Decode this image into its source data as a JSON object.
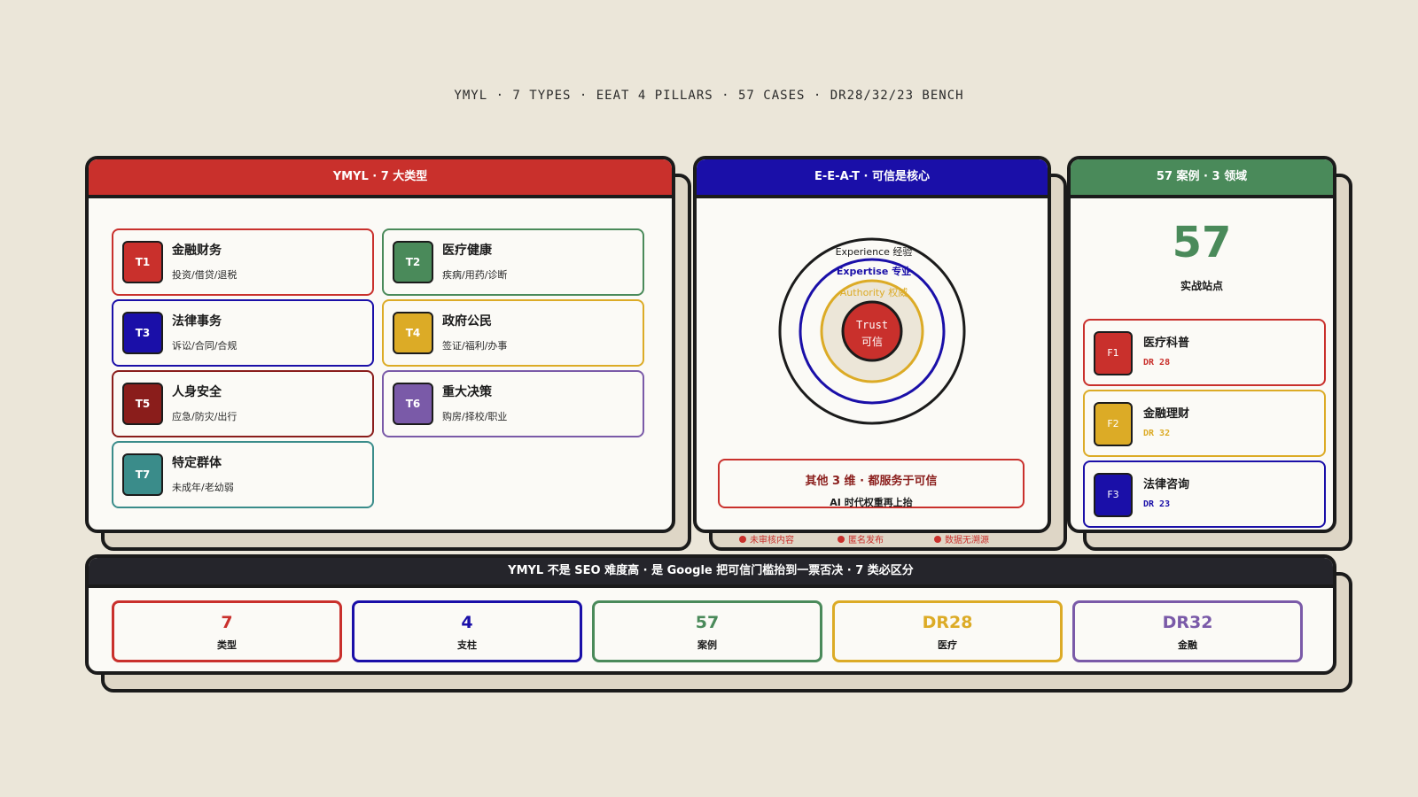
{
  "header_strip": "YMYL · 7 TYPES · EEAT 4 PILLARS · 57 CASES · DR28/32/23 BENCH",
  "colors": {
    "red": "#c9302c",
    "blue": "#1a0fa8",
    "green": "#4a8a5a",
    "yellow": "#dcab26",
    "darkred": "#8a1d1b",
    "purple": "#7a5aa8",
    "teal": "#3a8c8a",
    "dark": "#25252b"
  },
  "types_panel": {
    "title": "YMYL · 7 大类型",
    "items": [
      {
        "code": "T1",
        "title": "金融财务",
        "desc": "投资/借贷/退税",
        "color": "#c9302c"
      },
      {
        "code": "T2",
        "title": "医疗健康",
        "desc": "疾病/用药/诊断",
        "color": "#4a8a5a"
      },
      {
        "code": "T3",
        "title": "法律事务",
        "desc": "诉讼/合同/合规",
        "color": "#1a0fa8"
      },
      {
        "code": "T4",
        "title": "政府公民",
        "desc": "签证/福利/办事",
        "color": "#dcab26"
      },
      {
        "code": "T5",
        "title": "人身安全",
        "desc": "应急/防灾/出行",
        "color": "#8a1d1b"
      },
      {
        "code": "T6",
        "title": "重大决策",
        "desc": "购房/择校/职业",
        "color": "#7a5aa8"
      },
      {
        "code": "T7",
        "title": "特定群体",
        "desc": "未成年/老幼弱",
        "color": "#3a8c8a"
      }
    ]
  },
  "eeat_panel": {
    "title": "E-E-A-T · 可信是核心",
    "rings": {
      "experience": "Experience 经验",
      "expertise": "Expertise 专业",
      "authority": "Authority 权威",
      "trust_en": "Trust",
      "trust_cn": "可信"
    },
    "callout_title": "其他 3 维 · 都服务于可信",
    "callout_sub": "AI 时代权重再上抬",
    "notes": [
      "未审核内容",
      "匿名发布",
      "数据无溯源"
    ]
  },
  "cases_panel": {
    "title": "57 案例 · 3 领域",
    "big_number": "57",
    "big_label": "实战站点",
    "items": [
      {
        "code": "F1",
        "title": "医疗科普",
        "dr": "DR  28",
        "color": "#c9302c"
      },
      {
        "code": "F2",
        "title": "金融理财",
        "dr": "DR  32",
        "color": "#dcab26"
      },
      {
        "code": "F3",
        "title": "法律咨询",
        "dr": "DR  23",
        "color": "#1a0fa8"
      }
    ]
  },
  "bottom_panel": {
    "title": "YMYL 不是 SEO 难度高 · 是 Google 把可信门槛抬到一票否决 · 7 类必区分",
    "stats": [
      {
        "value": "7",
        "label": "类型",
        "color": "#c9302c"
      },
      {
        "value": "4",
        "label": "支柱",
        "color": "#1a0fa8"
      },
      {
        "value": "57",
        "label": "案例",
        "color": "#4a8a5a"
      },
      {
        "value": "DR28",
        "label": "医疗",
        "color": "#dcab26"
      },
      {
        "value": "DR32",
        "label": "金融",
        "color": "#7a5aa8"
      }
    ]
  }
}
